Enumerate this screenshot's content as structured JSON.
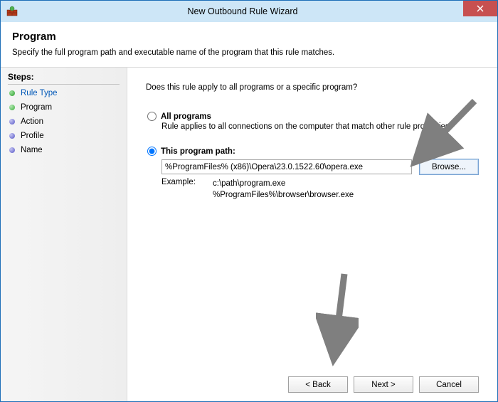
{
  "window": {
    "title": "New Outbound Rule Wizard",
    "close_tooltip": "Close"
  },
  "header": {
    "title": "Program",
    "subtitle": "Specify the full program path and executable name of the program that this rule matches."
  },
  "sidebar": {
    "title": "Steps:",
    "steps": [
      {
        "label": "Rule Type",
        "state": "done",
        "link": true
      },
      {
        "label": "Program",
        "state": "curr",
        "link": false
      },
      {
        "label": "Action",
        "state": "todo",
        "link": false
      },
      {
        "label": "Profile",
        "state": "todo",
        "link": false
      },
      {
        "label": "Name",
        "state": "todo",
        "link": false
      }
    ]
  },
  "content": {
    "question": "Does this rule apply to all programs or a specific program?",
    "option_all": {
      "label": "All programs",
      "description": "Rule applies to all connections on the computer that match other rule properties."
    },
    "option_path": {
      "label": "This program path:",
      "value": "%ProgramFiles% (x86)\\Opera\\23.0.1522.60\\opera.exe",
      "browse": "Browse...",
      "example_label": "Example:",
      "example_line1": "c:\\path\\program.exe",
      "example_line2": "%ProgramFiles%\\browser\\browser.exe"
    }
  },
  "footer": {
    "back": "< Back",
    "next": "Next >",
    "cancel": "Cancel"
  }
}
